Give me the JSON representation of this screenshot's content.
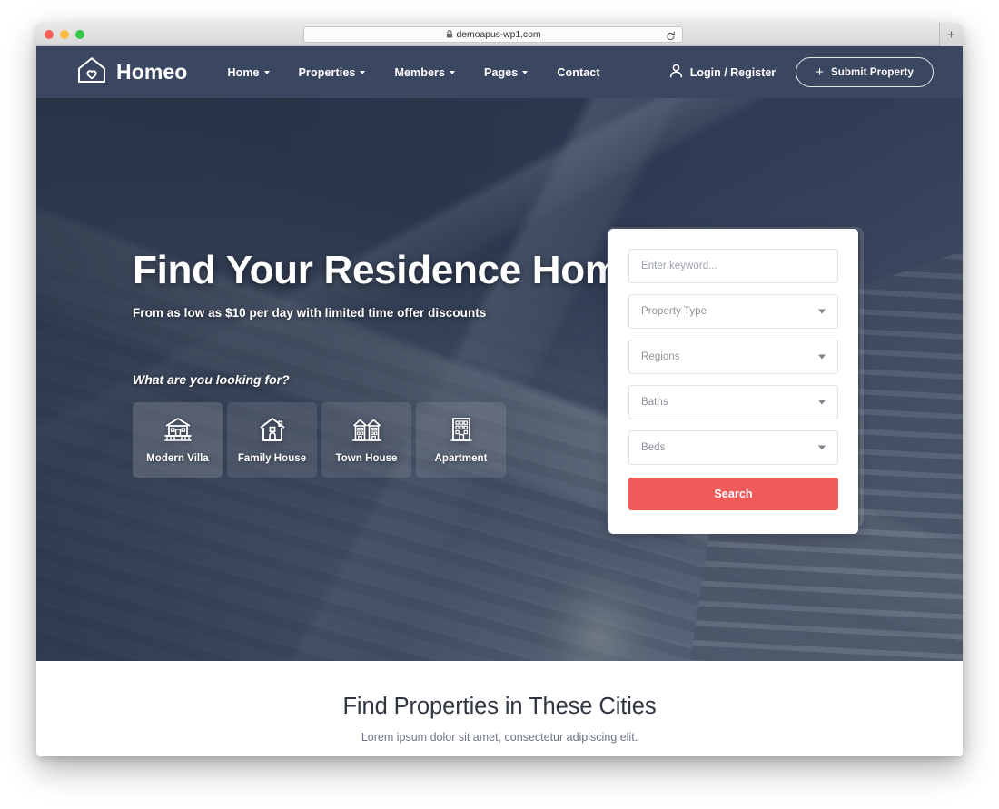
{
  "browser": {
    "url": "demoapus-wp1.com",
    "lock_icon": "lock-icon",
    "reload_icon": "reload-icon",
    "new_tab_label": "+"
  },
  "nav": {
    "brand": "Homeo",
    "brand_icon": "house-heart-logo-icon",
    "menu": [
      {
        "label": "Home",
        "has_caret": true
      },
      {
        "label": "Properties",
        "has_caret": true
      },
      {
        "label": "Members",
        "has_caret": true
      },
      {
        "label": "Pages",
        "has_caret": true
      },
      {
        "label": "Contact",
        "has_caret": false
      }
    ],
    "login_label": "Login / Register",
    "login_icon": "user-icon",
    "submit_label": "Submit Property",
    "submit_icon": "plus-icon"
  },
  "hero": {
    "title": "Find Your Residence Home",
    "subtitle": "From as low as $10 per day with limited time offer discounts",
    "looking_for": "What are you looking for?",
    "tiles": [
      {
        "label": "Modern Villa",
        "icon": "villa-icon",
        "active": true
      },
      {
        "label": "Family House",
        "icon": "house-icon",
        "active": false
      },
      {
        "label": "Town House",
        "icon": "townhouse-icon",
        "active": false
      },
      {
        "label": "Apartment",
        "icon": "apartment-icon",
        "active": false
      }
    ]
  },
  "search": {
    "keyword_placeholder": "Enter keyword...",
    "keyword_value": "",
    "property_type": "Property Type",
    "regions": "Regions",
    "baths": "Baths",
    "beds": "Beds",
    "button_label": "Search",
    "button_color": "#ef5b5b"
  },
  "cities": {
    "title": "Find Properties in These Cities",
    "subtitle": "Lorem ipsum dolor sit amet, consectetur adipiscing elit."
  },
  "colors": {
    "nav_bg": "#3b4760",
    "hero_bg": "#2e3a52",
    "accent": "#ef5b5b",
    "text_light": "#ffffff"
  }
}
